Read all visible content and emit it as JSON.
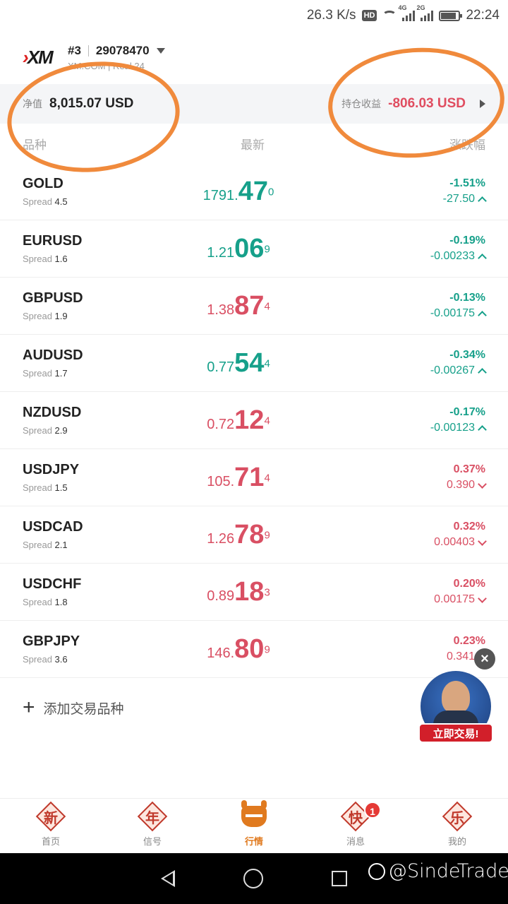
{
  "status": {
    "speed": "26.3 K/s",
    "hd": "HD",
    "net1": "4G",
    "net2": "2G",
    "time": "22:24"
  },
  "header": {
    "logo": "XM",
    "account_num": "#3",
    "account_id": "29078470",
    "account_sub": "XM.COM | Real 24"
  },
  "summary": {
    "equity_label": "净值",
    "equity_value": "8,015.07 USD",
    "pnl_label": "持仓收益",
    "pnl_value": "-806.03 USD"
  },
  "columns": {
    "symbol": "品种",
    "latest": "最新",
    "change": "涨跌幅"
  },
  "spread_label": "Spread",
  "quotes": [
    {
      "symbol": "GOLD",
      "spread": "4.5",
      "price_a": "1791.",
      "price_b": "47",
      "price_c": "0",
      "pct": "-1.51%",
      "abs": "-27.50",
      "dir": "up",
      "price_color": "up"
    },
    {
      "symbol": "EURUSD",
      "spread": "1.6",
      "price_a": "1.21",
      "price_b": "06",
      "price_c": "9",
      "pct": "-0.19%",
      "abs": "-0.00233",
      "dir": "up",
      "price_color": "up"
    },
    {
      "symbol": "GBPUSD",
      "spread": "1.9",
      "price_a": "1.38",
      "price_b": "87",
      "price_c": "4",
      "pct": "-0.13%",
      "abs": "-0.00175",
      "dir": "up",
      "price_color": "dn"
    },
    {
      "symbol": "AUDUSD",
      "spread": "1.7",
      "price_a": "0.77",
      "price_b": "54",
      "price_c": "4",
      "pct": "-0.34%",
      "abs": "-0.00267",
      "dir": "up",
      "price_color": "up"
    },
    {
      "symbol": "NZDUSD",
      "spread": "2.9",
      "price_a": "0.72",
      "price_b": "12",
      "price_c": "4",
      "pct": "-0.17%",
      "abs": "-0.00123",
      "dir": "up",
      "price_color": "dn"
    },
    {
      "symbol": "USDJPY",
      "spread": "1.5",
      "price_a": "105.",
      "price_b": "71",
      "price_c": "4",
      "pct": "0.37%",
      "abs": "0.390",
      "dir": "down",
      "price_color": "dn"
    },
    {
      "symbol": "USDCAD",
      "spread": "2.1",
      "price_a": "1.26",
      "price_b": "78",
      "price_c": "9",
      "pct": "0.32%",
      "abs": "0.00403",
      "dir": "down",
      "price_color": "dn"
    },
    {
      "symbol": "USDCHF",
      "spread": "1.8",
      "price_a": "0.89",
      "price_b": "18",
      "price_c": "3",
      "pct": "0.20%",
      "abs": "0.00175",
      "dir": "down",
      "price_color": "dn"
    },
    {
      "symbol": "GBPJPY",
      "spread": "3.6",
      "price_a": "146.",
      "price_b": "80",
      "price_c": "9",
      "pct": "0.23%",
      "abs": "0.341",
      "dir": "down",
      "price_color": "dn"
    }
  ],
  "add_label": "添加交易品种",
  "promo": {
    "button": "立即交易!",
    "close": "×"
  },
  "tabs": [
    {
      "char": "新",
      "label": "首页"
    },
    {
      "char": "年",
      "label": "信号"
    },
    {
      "char": "",
      "label": "行情"
    },
    {
      "char": "快",
      "label": "消息",
      "badge": "1"
    },
    {
      "char": "乐",
      "label": "我的"
    }
  ],
  "watermark": "@SindeTrade",
  "colors": {
    "up": "#16a08a",
    "down": "#d94f63",
    "accent": "#e07a1f"
  }
}
